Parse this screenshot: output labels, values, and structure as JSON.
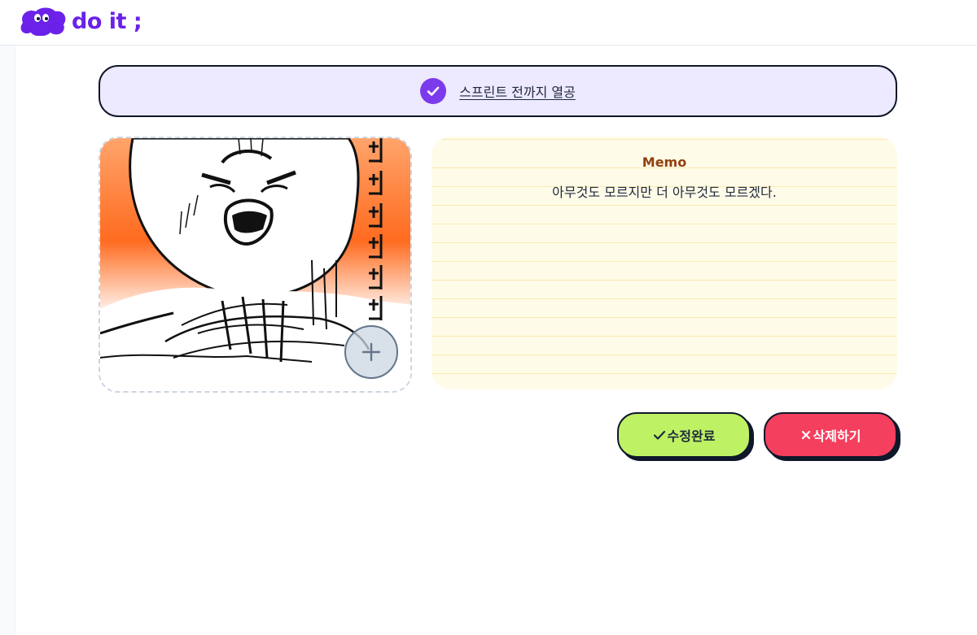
{
  "header": {
    "logo_text": "do it ;"
  },
  "todo": {
    "name": "스프린트 전까지 열공",
    "is_completed": true,
    "accent_color": "#7c3aed"
  },
  "image": {
    "alt": "",
    "add_button_icon": "plus-icon"
  },
  "memo": {
    "title": "Memo",
    "content": "아무것도 모르지만 더 아무것도 모르겠다."
  },
  "actions": {
    "save_label": "수정완료",
    "save_icon": "check-icon",
    "delete_label": "삭제하기",
    "delete_icon": "x-icon"
  },
  "colors": {
    "brand": "#6b21e8",
    "todo_bg": "#ede9fe",
    "memo_bg": "#fefbe8",
    "memo_title": "#92400e",
    "save_bg": "#bef264",
    "delete_bg": "#f43f5e"
  }
}
